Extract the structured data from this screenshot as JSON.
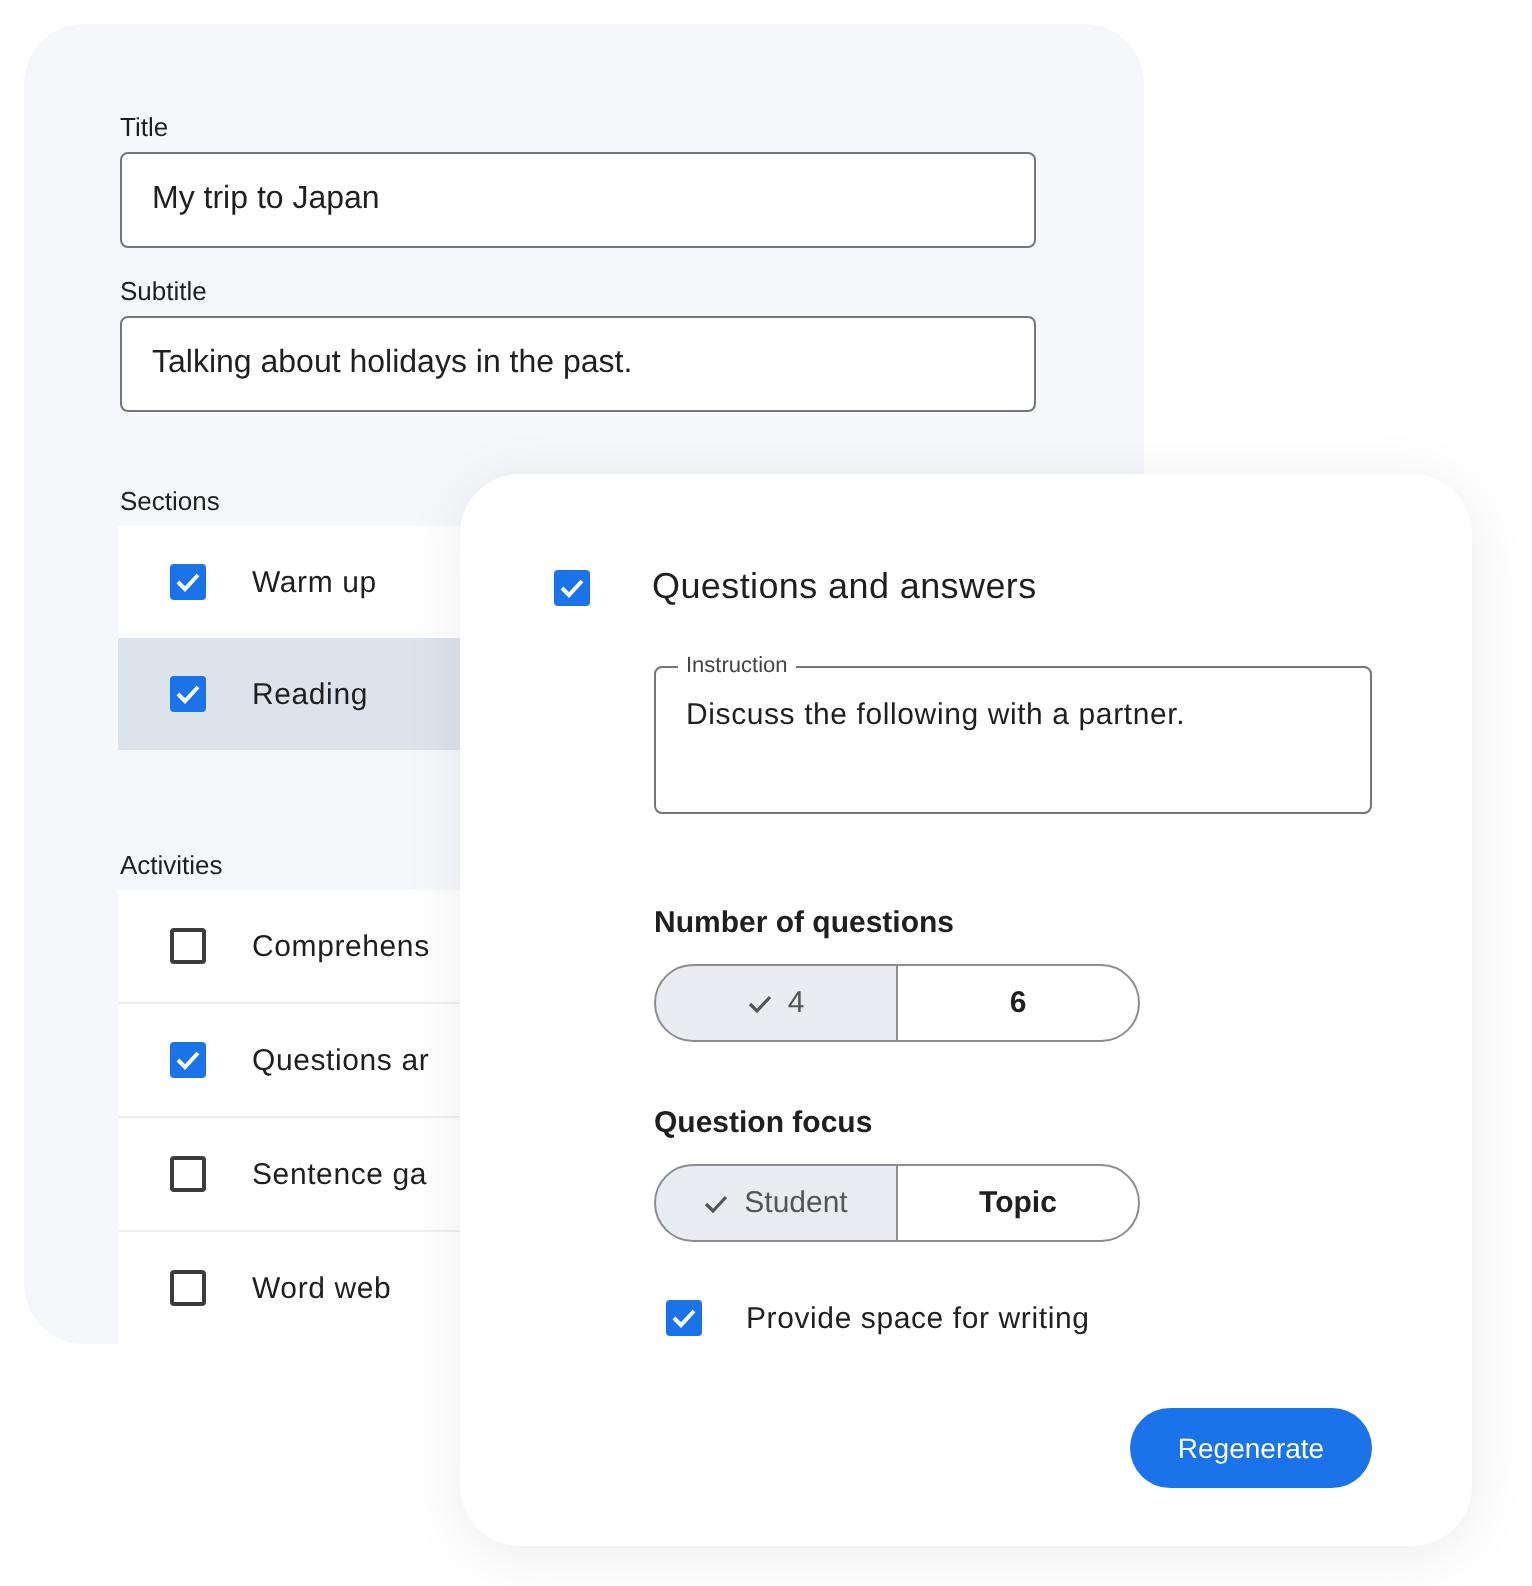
{
  "form": {
    "title": {
      "label": "Title",
      "value": "My trip to Japan"
    },
    "subtitle": {
      "label": "Subtitle",
      "value": "Talking about holidays in the past."
    },
    "sections": {
      "label": "Sections",
      "items": [
        {
          "label": "Warm up",
          "checked": true,
          "selected": false
        },
        {
          "label": "Reading",
          "checked": true,
          "selected": true
        }
      ]
    },
    "activities": {
      "label": "Activities",
      "items": [
        {
          "label": "Comprehens",
          "checked": false
        },
        {
          "label": "Questions ar",
          "checked": true
        },
        {
          "label": "Sentence ga",
          "checked": false
        },
        {
          "label": "Word web",
          "checked": false
        }
      ]
    }
  },
  "card": {
    "title": "Questions and answers",
    "checked": true,
    "instruction": {
      "label": "Instruction",
      "value": "Discuss the following with a partner."
    },
    "groups": [
      {
        "label": "Number of questions",
        "options": [
          {
            "label": "4",
            "selected": true
          },
          {
            "label": "6",
            "selected": false
          }
        ]
      },
      {
        "label": "Question focus",
        "options": [
          {
            "label": "Student",
            "selected": true
          },
          {
            "label": "Topic",
            "selected": false
          }
        ]
      }
    ],
    "writing": {
      "label": "Provide space for writing",
      "checked": true
    },
    "button": "Regenerate"
  }
}
